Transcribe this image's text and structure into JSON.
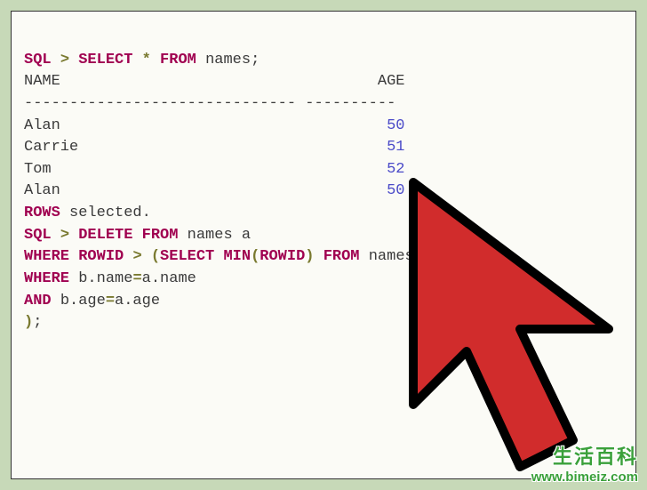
{
  "sql": {
    "prompt": "SQL",
    "gt": ">",
    "select": "SELECT",
    "star": "*",
    "from": "FROM",
    "table": "names",
    "semi": ";",
    "col1": "NAME",
    "col2": "AGE",
    "dashes1": "------------------------------",
    "dashes2": "----------",
    "rows": [
      {
        "name": "Alan",
        "age": "50"
      },
      {
        "name": "Carrie",
        "age": "51"
      },
      {
        "name": "Tom",
        "age": "52"
      },
      {
        "name": "Alan",
        "age": "50"
      }
    ],
    "rows_kw": "ROWS",
    "selected": "selected.",
    "delete": "DELETE",
    "from2": "FROM",
    "alias_a": "names a",
    "where": "WHERE",
    "rowid": "ROWID",
    "lparen": "(",
    "select2": "SELECT",
    "min": "MIN",
    "rowid2": "ROWID",
    "rparen": ")",
    "from3": "FROM",
    "alias_b": "names b",
    "where2": "WHERE",
    "bname": "b.name",
    "aname": "a.name",
    "eq": "=",
    "and": "AND",
    "bage": "b.age",
    "aage": "a.age",
    "close_paren": ")",
    "semi2": ";"
  },
  "watermark": {
    "top": "生活百科",
    "bottom": "www.bimeiz.com"
  },
  "colors": {
    "keyword": "#a00050",
    "operator": "#7a7a30",
    "number": "#4a4ac8",
    "cursor_fill": "#d12c2c",
    "cursor_stroke": "#000000",
    "bg": "#c7d9b8"
  }
}
